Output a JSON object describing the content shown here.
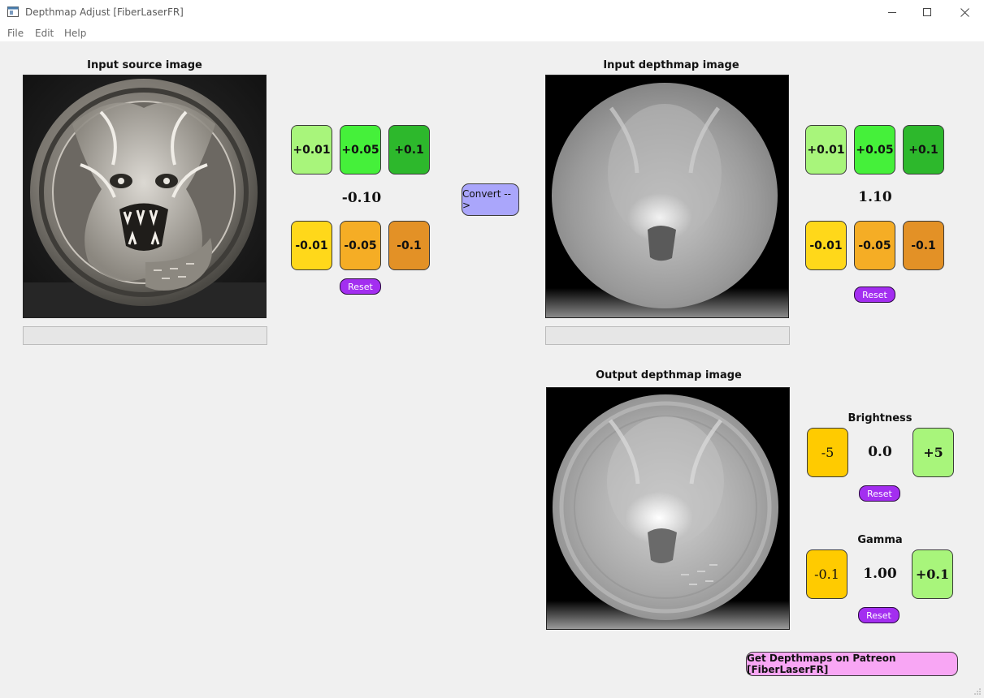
{
  "window": {
    "title": "Depthmap Adjust [FiberLaserFR]"
  },
  "menu": [
    "File",
    "Edit",
    "Help"
  ],
  "input_source": {
    "title": "Input source image",
    "value": "-0.10",
    "progress": 0
  },
  "input_depth": {
    "title": "Input depthmap image",
    "value": "1.10",
    "progress": 0
  },
  "buttons": {
    "inc": [
      "+0.01",
      "+0.05",
      "+0.1"
    ],
    "dec": [
      "-0.01",
      "-0.05",
      "-0.1"
    ],
    "reset": "Reset",
    "convert": "Convert -->"
  },
  "output": {
    "title": "Output depthmap image",
    "brightness": {
      "label": "Brightness",
      "value": "0.0",
      "minus": "-5",
      "plus": "+5"
    },
    "gamma": {
      "label": "Gamma",
      "value": "1.00",
      "minus": "-0.1",
      "plus": "+0.1"
    }
  },
  "patreon_button": "Get Depthmaps on Patreon [FiberLaserFR]",
  "colors": {
    "green_light": "#a8f57b",
    "green_mid": "#45f03a",
    "green_dark": "#2db82c",
    "yellow": "#ffd81a",
    "orange": "#f5ad25",
    "orange_dark": "#e39126",
    "reset_purple": "#a32ef0",
    "convert_lavender": "#aaa6fb",
    "patreon_pink": "#f8a6f4"
  }
}
